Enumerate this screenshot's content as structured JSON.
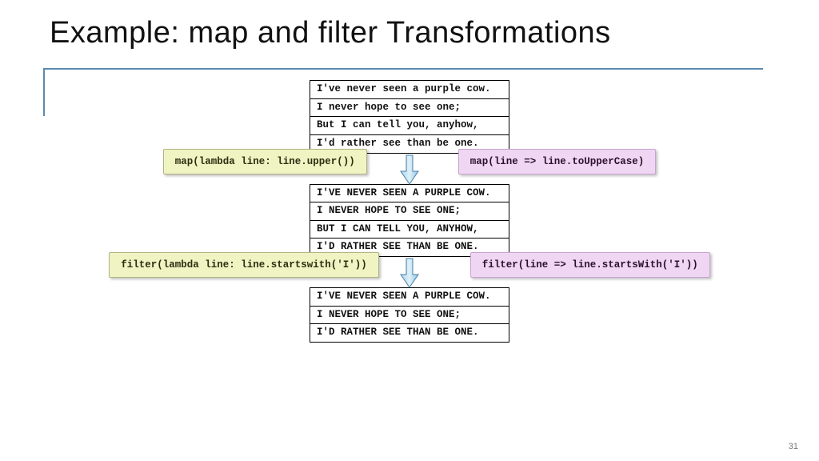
{
  "title": "Example: map and filter Transformations",
  "page_number": "31",
  "tables": {
    "original": [
      "I've never seen a purple cow.",
      "I never hope to see one;",
      "But I can tell you, anyhow,",
      "I'd rather see than be one."
    ],
    "mapped": [
      "I'VE NEVER SEEN A PURPLE COW.",
      "I NEVER HOPE TO SEE ONE;",
      "BUT I CAN TELL YOU, ANYHOW,",
      "I'D RATHER SEE THAN BE ONE."
    ],
    "filtered": [
      "I'VE NEVER SEEN A PURPLE COW.",
      "I NEVER HOPE TO SEE ONE;",
      "I'D RATHER SEE THAN BE ONE."
    ]
  },
  "ops": {
    "map_py": "map(lambda line: line.upper())",
    "map_sc": "map(line => line.toUpperCase)",
    "filter_py": "filter(lambda line: line.startswith('I'))",
    "filter_sc": "filter(line => line.startsWith('I'))"
  }
}
